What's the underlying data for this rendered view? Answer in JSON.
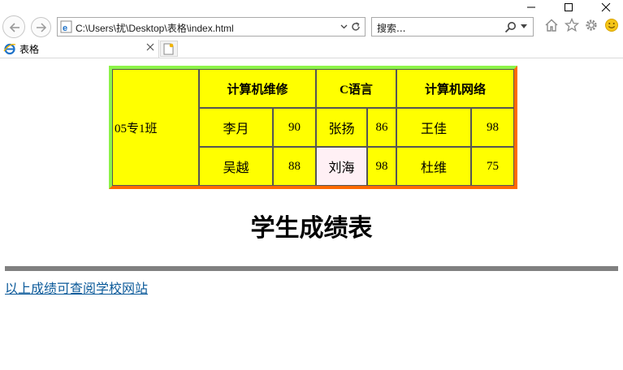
{
  "window": {
    "caption_buttons": [
      "minimize",
      "maximize",
      "close"
    ]
  },
  "toolbar": {
    "address": "C:\\Users\\扰\\Desktop\\表格\\index.html",
    "search_placeholder": "搜索...",
    "icons": [
      "back-icon",
      "forward-icon",
      "ie-page-icon",
      "refresh-icon",
      "search-icon",
      "home-icon",
      "favorites-star-icon",
      "settings-gear-icon",
      "feedback-smiley-icon"
    ]
  },
  "tabs": [
    {
      "title": "表格",
      "active": true
    }
  ],
  "table": {
    "class_name": "05专1班",
    "subjects": [
      "计算机维修",
      "C语言",
      "计算机网络"
    ],
    "rows": [
      [
        {
          "name": "李月",
          "score": "90"
        },
        {
          "name": "张扬",
          "score": "86"
        },
        {
          "name": "王佳",
          "score": "98"
        }
      ],
      [
        {
          "name": "吴越",
          "score": "88"
        },
        {
          "name": "刘海",
          "score": "98"
        },
        {
          "name": "杜维",
          "score": "75"
        }
      ]
    ],
    "colors": {
      "background": "#ffff00",
      "border_top_left": "#8cf348",
      "border_bottom_right": "#ff6a00",
      "highlight_cell": "#fff0f5"
    }
  },
  "page": {
    "heading": "学生成绩表",
    "link_text": "以上成绩可查阅学校网站"
  }
}
